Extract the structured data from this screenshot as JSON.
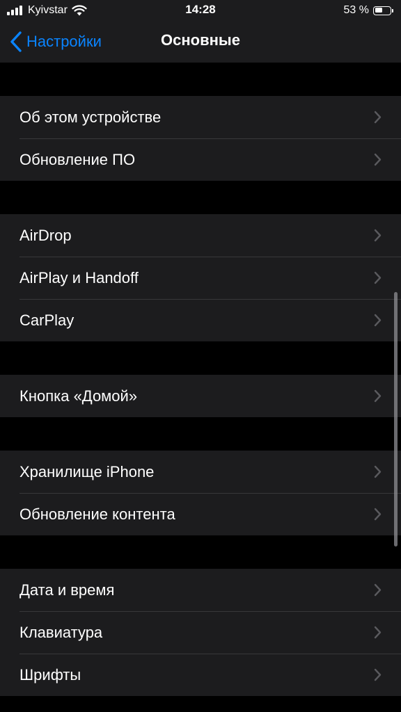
{
  "status_bar": {
    "carrier": "Kyivstar",
    "time": "14:28",
    "battery_text": "53 %",
    "battery_level": 0.53,
    "signal_bars": 4,
    "icons": [
      "signal-icon",
      "wifi-icon",
      "battery-icon"
    ]
  },
  "nav": {
    "back_label": "Настройки",
    "title": "Основные",
    "back_icon": "chevron-left-icon",
    "accent_color": "#0a84ff"
  },
  "groups": [
    {
      "items": [
        {
          "label": "Об этом устройстве"
        },
        {
          "label": "Обновление ПО"
        }
      ]
    },
    {
      "items": [
        {
          "label": "AirDrop"
        },
        {
          "label": "AirPlay и Handoff"
        },
        {
          "label": "CarPlay"
        }
      ]
    },
    {
      "items": [
        {
          "label": "Кнопка «Домой»"
        }
      ]
    },
    {
      "items": [
        {
          "label": "Хранилище iPhone"
        },
        {
          "label": "Обновление контента"
        }
      ]
    },
    {
      "items": [
        {
          "label": "Дата и время"
        },
        {
          "label": "Клавиатура"
        },
        {
          "label": "Шрифты"
        }
      ]
    }
  ],
  "colors": {
    "background": "#000000",
    "cell_background": "#1c1c1e",
    "separator": "#38383a",
    "chevron": "#5a5a5e",
    "text": "#ffffff"
  }
}
